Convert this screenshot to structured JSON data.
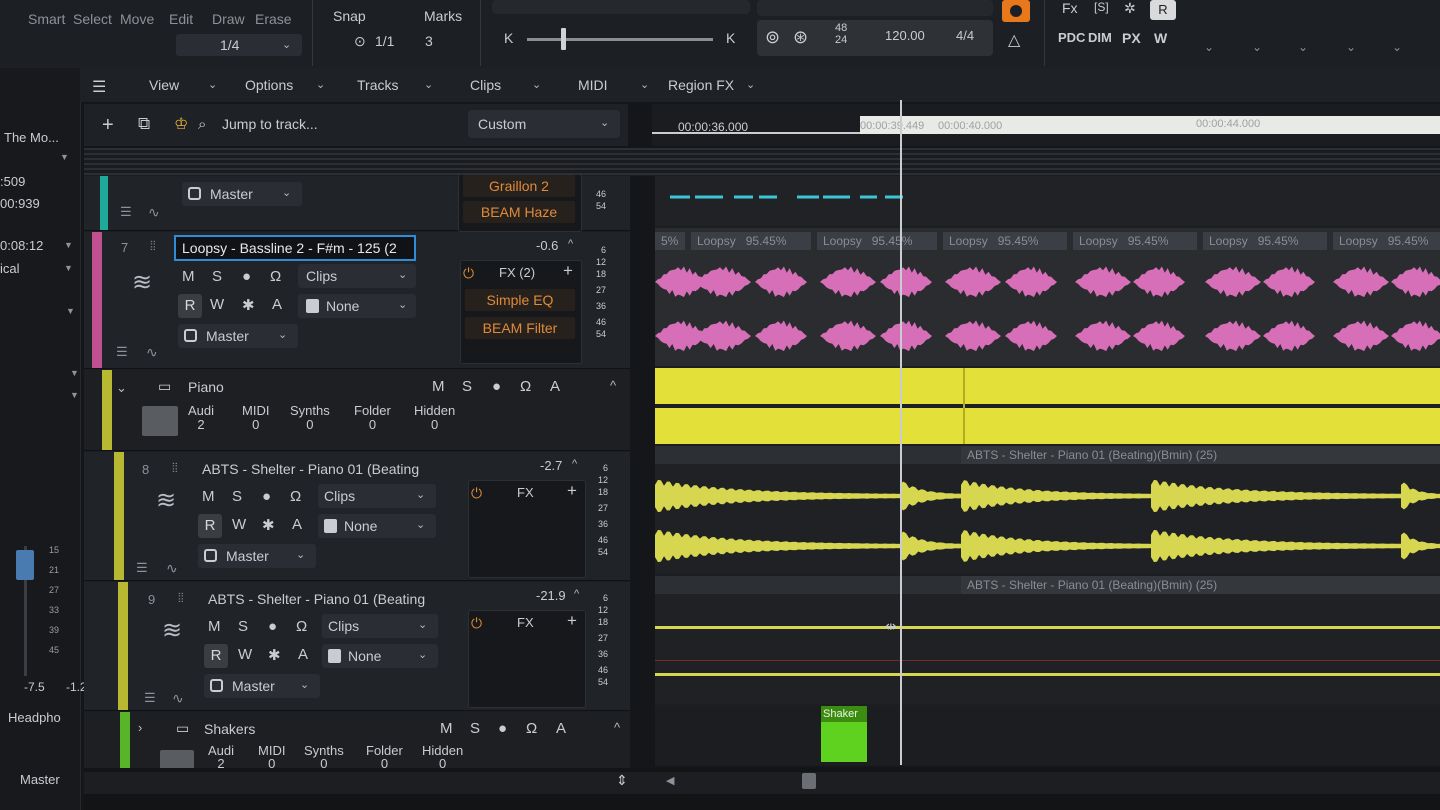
{
  "toolbar": {
    "tools": [
      "Smart",
      "Select",
      "Move",
      "Edit",
      "Draw",
      "Erase"
    ],
    "grid_value": "1/4",
    "snap_label": "Snap",
    "snap_value": "1/1",
    "marks_label": "Marks",
    "marks_value": "3",
    "zoom_start": "K",
    "zoom_end": "K",
    "time_sig_top": "48",
    "time_sig_bottom": "24",
    "tempo": "120.00",
    "meter": "4/4",
    "right_labels": [
      "PDC",
      "DIM",
      "PX",
      "W"
    ]
  },
  "menu": {
    "view": "View",
    "options": "Options",
    "tracks": "Tracks",
    "clips": "Clips",
    "midi": "MIDI",
    "region_fx": "Region FX"
  },
  "track_header": {
    "jump_placeholder": "Jump to track...",
    "preset": "Custom"
  },
  "ruler": {
    "marks": [
      "00:00:36.000",
      "00:00:39.449",
      "00:00:40.000",
      "00:00:44.000"
    ]
  },
  "left_panel": {
    "project": "The Mo...",
    "times": [
      ":509",
      "00:939",
      "0:08:12",
      "ical"
    ],
    "fader_scale": [
      "15",
      "21",
      "27",
      "33",
      "39",
      "45"
    ],
    "fader_values": [
      "-7.5",
      "-1.2"
    ],
    "output": "Headpho",
    "master": "Master"
  },
  "tracks": [
    {
      "id": "top",
      "output": "Master",
      "fx": [
        "Graillon 2",
        "BEAM Haze"
      ],
      "meter": [
        "46",
        "54"
      ]
    },
    {
      "number": "7",
      "name": "Loopsy - Bassline 2 - F#m - 125 (2",
      "level": "-0.6",
      "buttons": [
        "M",
        "S",
        "●",
        "Ω",
        "R",
        "W",
        "✱",
        "A"
      ],
      "input": "Clips",
      "input2": "None",
      "output": "Master",
      "fx_label": "FX (2)",
      "fx": [
        "Simple EQ",
        "BEAM Filter"
      ],
      "meter": [
        "6",
        "12",
        "18",
        "27",
        "36",
        "46",
        "54"
      ]
    },
    {
      "folder": "Piano",
      "stats_labels": [
        "Audi",
        "MIDI",
        "Synths",
        "Folder",
        "Hidden"
      ],
      "stats_values": [
        "2",
        "0",
        "0",
        "0",
        "0"
      ]
    },
    {
      "number": "8",
      "name": "ABTS - Shelter - Piano 01 (Beating",
      "level": "-2.7",
      "input": "Clips",
      "input2": "None",
      "output": "Master",
      "fx_label": "FX",
      "meter": [
        "6",
        "12",
        "18",
        "27",
        "36",
        "46",
        "54"
      ]
    },
    {
      "number": "9",
      "name": "ABTS - Shelter - Piano 01 (Beating",
      "level": "-21.9",
      "input": "Clips",
      "input2": "None",
      "output": "Master",
      "fx_label": "FX",
      "meter": [
        "6",
        "12",
        "18",
        "27",
        "36",
        "46",
        "54"
      ]
    },
    {
      "folder": "Shakers",
      "stats_labels": [
        "Audi",
        "MIDI",
        "Synths",
        "Folder",
        "Hidden"
      ],
      "stats_values": [
        "2",
        "0",
        "0",
        "0",
        "0"
      ]
    }
  ],
  "clips": {
    "loopsy_name": "Loopsy",
    "loopsy_pct": "95.45%",
    "loopsy_first": "5%",
    "piano_clip": "ABTS - Shelter - Piano 01 (Beating)(Bmin) (25)",
    "shaker_clip": "Shaker"
  },
  "colors": {
    "track_teal": "#1fa99a",
    "track_pink": "#c0508f",
    "track_yellow": "#b8b832",
    "track_green": "#58b52a",
    "wave_pink": "#d76fb8",
    "wave_yellow": "#d7d650",
    "folder_yellow": "#e4e03a",
    "fx_orange": "#e08a3a",
    "selection": "#2f8cd6"
  }
}
